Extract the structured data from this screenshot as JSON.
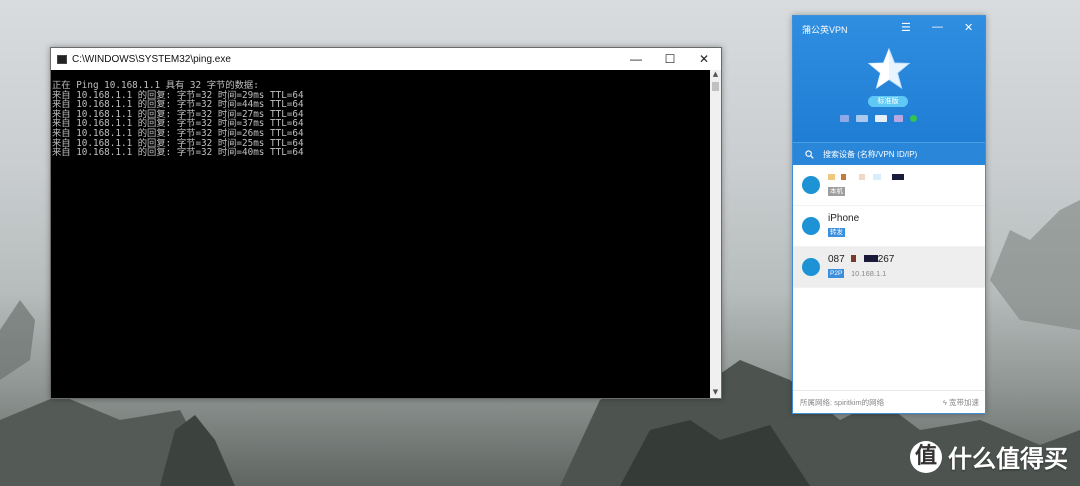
{
  "cmd": {
    "title": "C:\\WINDOWS\\SYSTEM32\\ping.exe",
    "lines": [
      "正在 Ping 10.168.1.1 具有 32 字节的数据:",
      "来自 10.168.1.1 的回复: 字节=32 时间=29ms TTL=64",
      "来自 10.168.1.1 的回复: 字节=32 时间=44ms TTL=64",
      "来自 10.168.1.1 的回复: 字节=32 时间=27ms TTL=64",
      "来自 10.168.1.1 的回复: 字节=32 时间=37ms TTL=64",
      "来自 10.168.1.1 的回复: 字节=32 时间=26ms TTL=64",
      "来自 10.168.1.1 的回复: 字节=32 时间=25ms TTL=64",
      "来自 10.168.1.1 的回复: 字节=32 时间=40ms TTL=64"
    ],
    "minimize": "—",
    "maximize": "☐",
    "close": "✕"
  },
  "vpn": {
    "title": "蒲公英VPN",
    "menu": "☰",
    "minimize": "—",
    "close": "✕",
    "edition_badge": "标准版",
    "search_placeholder": "搜索设备 (名称/VPN ID/IP)",
    "devices": [
      {
        "name": "",
        "tag": "本机",
        "tag_color": "#9e9e9e",
        "ip": ""
      },
      {
        "name": "iPhone",
        "tag": "转发",
        "tag_color": "#3b8fdc",
        "ip": ""
      },
      {
        "name": "087",
        "name_suffix": "267",
        "tag": "P2P",
        "tag_color": "#3b8fdc",
        "ip": "10.168.1.1"
      }
    ],
    "footer_network": "所属网络: spiritkim的网络",
    "footer_speed": "宽带加速"
  },
  "watermark": {
    "logo": "值",
    "text": "什么值得买"
  },
  "colors": {
    "vpn_blue": "#1f7ed4",
    "online_green": "#36c24f"
  }
}
